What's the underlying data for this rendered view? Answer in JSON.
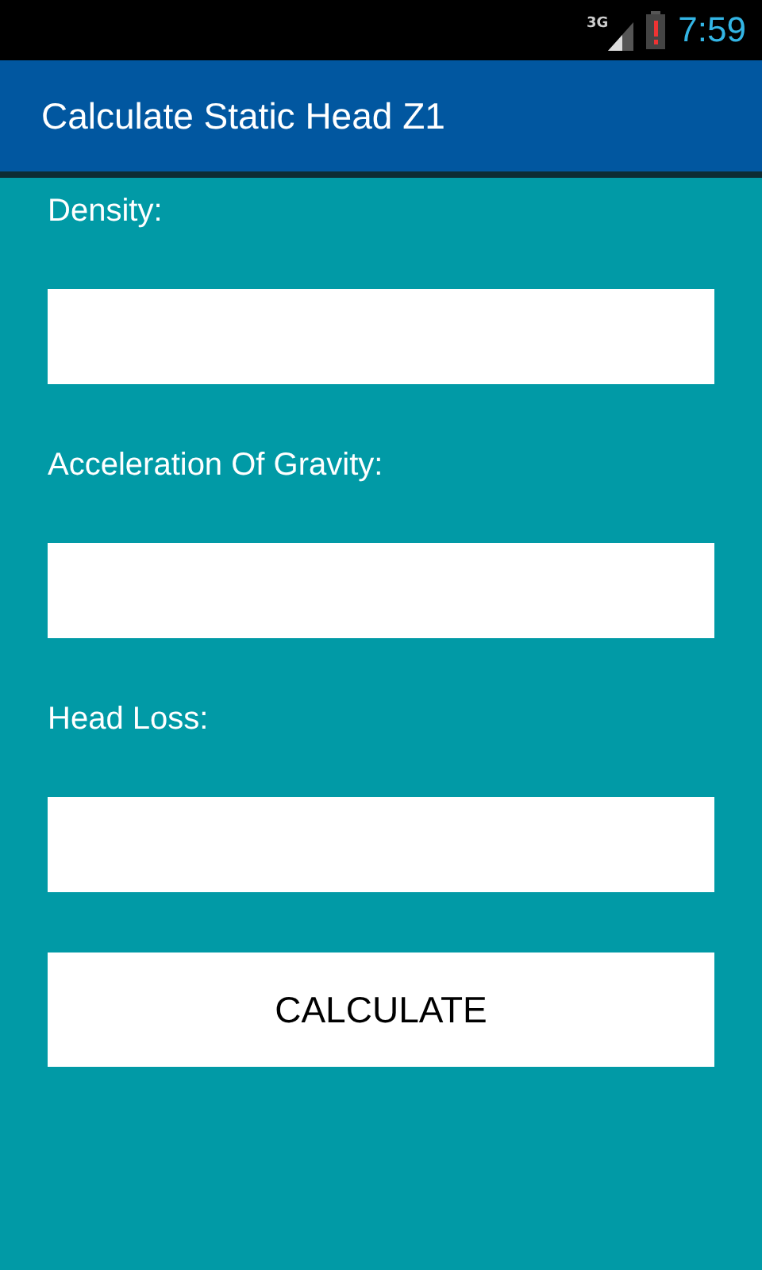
{
  "status_bar": {
    "network": "3G",
    "time": "7:59"
  },
  "app_bar": {
    "title": "Calculate Static Head Z1"
  },
  "fields": [
    {
      "label": "Density:"
    },
    {
      "label": "Acceleration Of Gravity:"
    },
    {
      "label": "Head Loss:"
    }
  ],
  "button": {
    "label": "CALCULATE"
  }
}
